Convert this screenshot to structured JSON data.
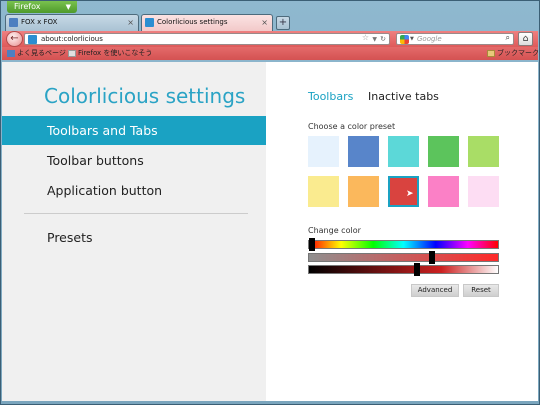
{
  "app": {
    "name": "Firefox"
  },
  "tabs": [
    {
      "title": "FOX x FOX"
    },
    {
      "title": "Colorlicious settings"
    }
  ],
  "newtab": "+",
  "nav": {
    "back": "←",
    "url": "about:colorlicious",
    "search_placeholder": "Google",
    "home": "⌂"
  },
  "bookmarks": [
    {
      "label": "よく見るページ"
    },
    {
      "label": "Firefox を使いこなそう"
    },
    {
      "label": "ブックマーク"
    }
  ],
  "sidebar": {
    "title": "Colorlicious settings",
    "items": [
      {
        "label": "Toolbars and Tabs",
        "active": true
      },
      {
        "label": "Toolbar buttons"
      },
      {
        "label": "Application button"
      },
      {
        "label": "Presets"
      }
    ]
  },
  "main": {
    "tabs": [
      {
        "label": "Toolbars",
        "active": true
      },
      {
        "label": "Inactive tabs"
      }
    ],
    "preset_label": "Choose a color preset",
    "presets": [
      {
        "color": "#e6f2fd"
      },
      {
        "color": "#5885ca"
      },
      {
        "color": "#5cd8d8"
      },
      {
        "color": "#5cc45c"
      },
      {
        "color": "#a9dd66"
      },
      {
        "color": "#faeb8f"
      },
      {
        "color": "#fbb85c"
      },
      {
        "color": "#d9433f",
        "selected": true
      },
      {
        "color": "#fb80c6"
      },
      {
        "color": "#fdddf3"
      }
    ],
    "change_color_label": "Change color",
    "sliders": {
      "hue": 0.0,
      "saturation": 0.65,
      "brightness": 0.57
    },
    "advanced_label": "Advanced",
    "reset_label": "Reset"
  },
  "colors": {
    "accent": "#1aa2c3",
    "toolbar": "#de5a5a"
  }
}
